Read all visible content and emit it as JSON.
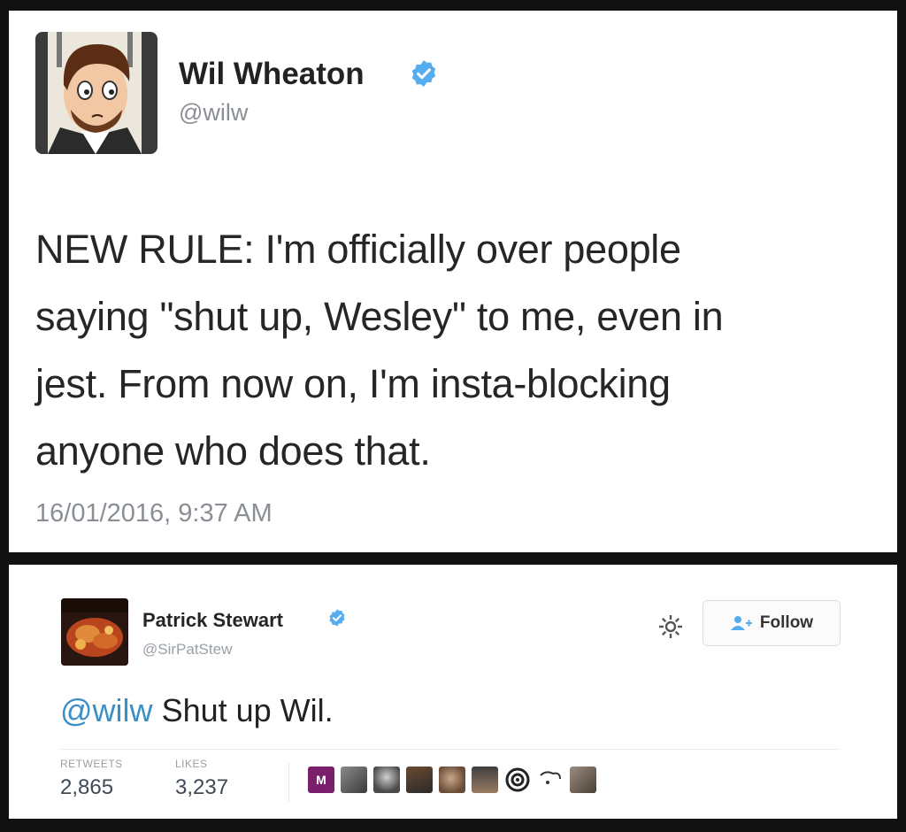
{
  "tweets": [
    {
      "author_name": "Wil Wheaton",
      "handle": "@wilw",
      "text_lines": [
        "NEW RULE: I'm officially over people",
        "saying \"shut up, Wesley\" to me, even in",
        "jest. From now on, I'm insta-blocking",
        "anyone who does that."
      ],
      "timestamp": "16/01/2016, 9:37 AM"
    },
    {
      "author_name": "Patrick Stewart",
      "handle": "@SirPatStew",
      "follow_label": "Follow",
      "mention": "@wilw",
      "text": "Shut up Wil.",
      "retweets_label": "RETWEETS",
      "retweets_value": "2,865",
      "likes_label": "LIKES",
      "likes_value": "3,237",
      "liker_badge": "M"
    }
  ],
  "colors": {
    "verified": "#55acee",
    "mention": "#3a8fc7",
    "frame": "#111111"
  },
  "icons": [
    "verified-badge-icon",
    "gear-icon",
    "follow-person-icon"
  ]
}
